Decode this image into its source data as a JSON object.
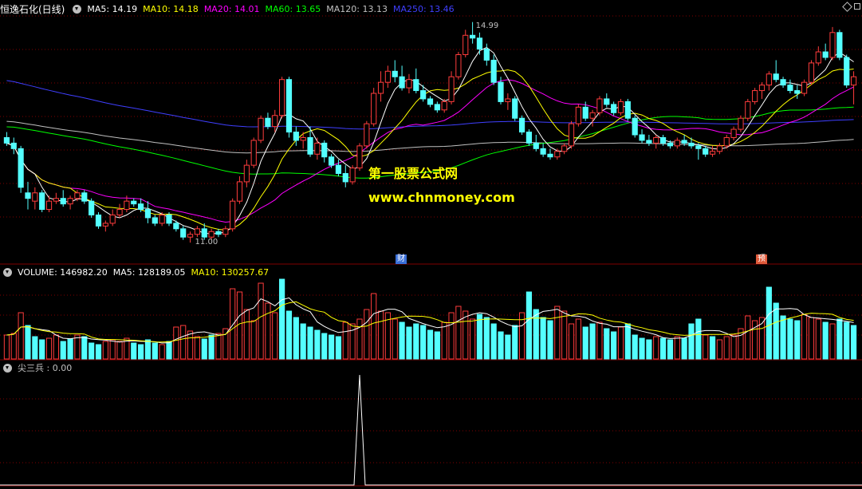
{
  "header": {
    "title": "恒逸石化(日线)",
    "indicators": [
      {
        "label": "MA5: 14.19",
        "color": "#ffffff"
      },
      {
        "label": "MA10: 14.18",
        "color": "#ffff00"
      },
      {
        "label": "MA20: 14.01",
        "color": "#ff00ff"
      },
      {
        "label": "MA60: 13.65",
        "color": "#00ff00"
      },
      {
        "label": "MA120: 13.13",
        "color": "#c0c0c0"
      },
      {
        "label": "MA250: 13.46",
        "color": "#3f3fff"
      }
    ]
  },
  "volume_header": {
    "indicators": [
      {
        "label": "VOLUME: 146982.20",
        "color": "#ffffff"
      },
      {
        "label": "MA5: 128189.05",
        "color": "#ffffff"
      },
      {
        "label": "MA10: 130257.67",
        "color": "#ffff00"
      }
    ]
  },
  "signal_header": {
    "indicators": [
      {
        "label": "尖三兵 : 0.00",
        "color": "#c0c0c0"
      }
    ]
  },
  "annotations": {
    "high_label": "14.99",
    "low_label": "11.00",
    "flag_financial": "财",
    "flag_forecast": "预"
  },
  "watermark": {
    "line1": "第一股票公式网",
    "line2": "www.chnmoney.com"
  },
  "colors": {
    "up": "#ff3c3c",
    "down": "#54ffff",
    "grid": "#800000",
    "ma5": "#ffffff",
    "ma10": "#ffff00",
    "ma20": "#ff00ff",
    "ma60": "#00ff00",
    "ma120": "#c0c0c0",
    "ma250": "#3f3fff",
    "signal": "#ffffff"
  },
  "chart_data": {
    "type": "candlestick",
    "ylim": [
      10.8,
      15.1
    ],
    "candles": [
      [
        12.9,
        13.0,
        12.75,
        12.8
      ],
      [
        12.8,
        12.9,
        12.6,
        12.7
      ],
      [
        12.7,
        12.75,
        11.9,
        12.0
      ],
      [
        11.9,
        12.1,
        11.6,
        11.8
      ],
      [
        11.75,
        12.0,
        11.6,
        11.9
      ],
      [
        11.9,
        11.95,
        11.55,
        11.6
      ],
      [
        11.6,
        11.85,
        11.55,
        11.75
      ],
      [
        11.75,
        11.9,
        11.7,
        11.8
      ],
      [
        11.8,
        11.95,
        11.65,
        11.7
      ],
      [
        11.7,
        11.85,
        11.6,
        11.8
      ],
      [
        11.8,
        11.95,
        11.75,
        11.9
      ],
      [
        11.9,
        11.95,
        11.7,
        11.75
      ],
      [
        11.75,
        11.8,
        11.45,
        11.5
      ],
      [
        11.5,
        11.55,
        11.25,
        11.3
      ],
      [
        11.3,
        11.4,
        11.2,
        11.35
      ],
      [
        11.35,
        11.6,
        11.3,
        11.5
      ],
      [
        11.5,
        11.7,
        11.45,
        11.6
      ],
      [
        11.6,
        11.85,
        11.55,
        11.75
      ],
      [
        11.75,
        11.8,
        11.65,
        11.7
      ],
      [
        11.7,
        11.8,
        11.55,
        11.6
      ],
      [
        11.6,
        11.75,
        11.35,
        11.45
      ],
      [
        11.45,
        11.5,
        11.3,
        11.35
      ],
      [
        11.35,
        11.55,
        11.3,
        11.5
      ],
      [
        11.5,
        11.55,
        11.3,
        11.35
      ],
      [
        11.35,
        11.4,
        11.2,
        11.25
      ],
      [
        11.25,
        11.3,
        11.05,
        11.1
      ],
      [
        11.1,
        11.2,
        11.0,
        11.15
      ],
      [
        11.15,
        11.3,
        11.1,
        11.25
      ],
      [
        11.25,
        11.35,
        11.05,
        11.1
      ],
      [
        11.1,
        11.25,
        11.05,
        11.2
      ],
      [
        11.2,
        11.25,
        11.1,
        11.15
      ],
      [
        11.15,
        11.3,
        11.1,
        11.25
      ],
      [
        11.25,
        11.8,
        11.2,
        11.75
      ],
      [
        11.75,
        12.2,
        11.7,
        12.1
      ],
      [
        12.1,
        12.5,
        12.0,
        12.4
      ],
      [
        12.4,
        12.9,
        12.35,
        12.85
      ],
      [
        12.85,
        13.3,
        12.8,
        13.25
      ],
      [
        13.25,
        13.35,
        13.05,
        13.1
      ],
      [
        13.1,
        13.4,
        13.0,
        13.3
      ],
      [
        13.3,
        14.0,
        13.25,
        13.95
      ],
      [
        13.95,
        14.0,
        12.9,
        13.0
      ],
      [
        13.0,
        13.1,
        12.75,
        12.85
      ],
      [
        12.85,
        13.0,
        12.7,
        12.9
      ],
      [
        12.9,
        13.1,
        12.55,
        12.6
      ],
      [
        12.6,
        12.9,
        12.5,
        12.8
      ],
      [
        12.8,
        12.85,
        12.45,
        12.55
      ],
      [
        12.55,
        12.6,
        12.35,
        12.4
      ],
      [
        12.4,
        12.5,
        12.2,
        12.25
      ],
      [
        12.25,
        12.4,
        12.0,
        12.1
      ],
      [
        12.1,
        12.4,
        12.05,
        12.35
      ],
      [
        12.35,
        12.8,
        12.3,
        12.75
      ],
      [
        12.75,
        13.2,
        12.7,
        13.15
      ],
      [
        13.15,
        13.8,
        13.1,
        13.7
      ],
      [
        13.7,
        14.1,
        13.55,
        13.9
      ],
      [
        13.9,
        14.2,
        13.8,
        14.1
      ],
      [
        14.1,
        14.3,
        13.9,
        14.0
      ],
      [
        14.0,
        14.2,
        13.75,
        13.8
      ],
      [
        13.8,
        14.05,
        13.7,
        13.95
      ],
      [
        13.95,
        14.15,
        13.7,
        13.75
      ],
      [
        13.75,
        13.85,
        13.55,
        13.6
      ],
      [
        13.6,
        13.65,
        13.45,
        13.5
      ],
      [
        13.5,
        13.55,
        13.35,
        13.4
      ],
      [
        13.4,
        13.6,
        13.35,
        13.55
      ],
      [
        13.55,
        14.1,
        13.5,
        14.0
      ],
      [
        14.0,
        14.45,
        13.95,
        14.4
      ],
      [
        14.4,
        14.85,
        14.35,
        14.75
      ],
      [
        14.75,
        14.99,
        14.6,
        14.7
      ],
      [
        14.7,
        14.8,
        14.4,
        14.5
      ],
      [
        14.5,
        14.6,
        14.2,
        14.3
      ],
      [
        14.3,
        14.4,
        13.85,
        13.9
      ],
      [
        13.9,
        14.0,
        13.5,
        13.55
      ],
      [
        13.55,
        13.7,
        13.4,
        13.6
      ],
      [
        13.6,
        13.65,
        13.2,
        13.25
      ],
      [
        13.25,
        13.3,
        12.95,
        13.0
      ],
      [
        13.0,
        13.05,
        12.75,
        12.8
      ],
      [
        12.8,
        12.95,
        12.65,
        12.7
      ],
      [
        12.7,
        12.8,
        12.55,
        12.6
      ],
      [
        12.6,
        12.7,
        12.5,
        12.55
      ],
      [
        12.55,
        12.7,
        12.5,
        12.65
      ],
      [
        12.65,
        12.8,
        12.6,
        12.75
      ],
      [
        12.75,
        13.2,
        12.7,
        13.15
      ],
      [
        13.15,
        13.5,
        13.1,
        13.45
      ],
      [
        13.45,
        13.55,
        13.2,
        13.25
      ],
      [
        13.25,
        13.4,
        13.1,
        13.35
      ],
      [
        13.35,
        13.65,
        13.3,
        13.6
      ],
      [
        13.6,
        13.7,
        13.45,
        13.5
      ],
      [
        13.5,
        13.55,
        13.3,
        13.35
      ],
      [
        13.35,
        13.6,
        13.3,
        13.55
      ],
      [
        13.55,
        13.6,
        13.2,
        13.25
      ],
      [
        13.25,
        13.3,
        12.9,
        12.95
      ],
      [
        12.95,
        13.05,
        12.8,
        12.85
      ],
      [
        12.85,
        12.95,
        12.75,
        12.8
      ],
      [
        12.8,
        12.95,
        12.7,
        12.9
      ],
      [
        12.9,
        12.95,
        12.75,
        12.8
      ],
      [
        12.8,
        12.85,
        12.7,
        12.75
      ],
      [
        12.75,
        12.9,
        12.7,
        12.85
      ],
      [
        12.85,
        12.95,
        12.75,
        12.8
      ],
      [
        12.8,
        12.9,
        12.7,
        12.75
      ],
      [
        12.75,
        12.8,
        12.5,
        12.7
      ],
      [
        12.7,
        12.75,
        12.55,
        12.6
      ],
      [
        12.6,
        12.75,
        12.55,
        12.65
      ],
      [
        12.65,
        12.8,
        12.6,
        12.75
      ],
      [
        12.75,
        12.95,
        12.7,
        12.9
      ],
      [
        12.9,
        13.1,
        12.85,
        13.05
      ],
      [
        13.05,
        13.3,
        13.0,
        13.25
      ],
      [
        13.25,
        13.6,
        13.2,
        13.55
      ],
      [
        13.55,
        13.8,
        13.5,
        13.75
      ],
      [
        13.75,
        13.9,
        13.6,
        13.85
      ],
      [
        13.85,
        14.1,
        13.75,
        14.05
      ],
      [
        14.05,
        14.3,
        13.9,
        13.95
      ],
      [
        13.95,
        14.0,
        13.8,
        13.85
      ],
      [
        13.85,
        13.95,
        13.7,
        13.75
      ],
      [
        13.75,
        13.85,
        13.6,
        13.7
      ],
      [
        13.7,
        13.95,
        13.65,
        13.9
      ],
      [
        13.9,
        14.3,
        13.85,
        14.25
      ],
      [
        14.25,
        14.55,
        14.2,
        14.45
      ],
      [
        14.45,
        14.6,
        14.3,
        14.35
      ],
      [
        14.35,
        14.9,
        14.3,
        14.8
      ],
      [
        14.8,
        14.85,
        14.3,
        14.35
      ],
      [
        14.35,
        14.4,
        13.8,
        13.85
      ],
      [
        13.85,
        14.1,
        13.5,
        14.0
      ]
    ],
    "volume": [
      [
        30,
        1
      ],
      [
        32,
        1
      ],
      [
        58,
        1
      ],
      [
        42,
        0
      ],
      [
        28,
        0
      ],
      [
        24,
        0
      ],
      [
        26,
        1
      ],
      [
        30,
        1
      ],
      [
        22,
        0
      ],
      [
        25,
        0
      ],
      [
        30,
        1
      ],
      [
        28,
        0
      ],
      [
        20,
        0
      ],
      [
        18,
        0
      ],
      [
        22,
        1
      ],
      [
        24,
        1
      ],
      [
        22,
        1
      ],
      [
        26,
        1
      ],
      [
        20,
        0
      ],
      [
        18,
        0
      ],
      [
        24,
        0
      ],
      [
        20,
        0
      ],
      [
        18,
        1
      ],
      [
        22,
        0
      ],
      [
        40,
        1
      ],
      [
        42,
        1
      ],
      [
        35,
        1
      ],
      [
        28,
        1
      ],
      [
        25,
        0
      ],
      [
        30,
        0
      ],
      [
        32,
        1
      ],
      [
        38,
        1
      ],
      [
        88,
        1
      ],
      [
        84,
        1
      ],
      [
        62,
        1
      ],
      [
        48,
        1
      ],
      [
        95,
        1
      ],
      [
        70,
        1
      ],
      [
        58,
        1
      ],
      [
        100,
        0
      ],
      [
        60,
        0
      ],
      [
        52,
        0
      ],
      [
        44,
        0
      ],
      [
        40,
        0
      ],
      [
        36,
        0
      ],
      [
        32,
        0
      ],
      [
        30,
        0
      ],
      [
        28,
        0
      ],
      [
        46,
        1
      ],
      [
        44,
        1
      ],
      [
        50,
        1
      ],
      [
        62,
        1
      ],
      [
        82,
        1
      ],
      [
        60,
        1
      ],
      [
        58,
        1
      ],
      [
        50,
        1
      ],
      [
        46,
        0
      ],
      [
        40,
        0
      ],
      [
        44,
        0
      ],
      [
        42,
        0
      ],
      [
        36,
        0
      ],
      [
        34,
        0
      ],
      [
        46,
        1
      ],
      [
        58,
        1
      ],
      [
        66,
        1
      ],
      [
        60,
        1
      ],
      [
        50,
        1
      ],
      [
        56,
        0
      ],
      [
        52,
        0
      ],
      [
        44,
        0
      ],
      [
        34,
        0
      ],
      [
        30,
        0
      ],
      [
        42,
        0
      ],
      [
        58,
        1
      ],
      [
        84,
        0
      ],
      [
        62,
        0
      ],
      [
        52,
        0
      ],
      [
        48,
        0
      ],
      [
        66,
        1
      ],
      [
        60,
        1
      ],
      [
        44,
        1
      ],
      [
        50,
        1
      ],
      [
        40,
        0
      ],
      [
        44,
        0
      ],
      [
        46,
        1
      ],
      [
        38,
        0
      ],
      [
        34,
        0
      ],
      [
        40,
        1
      ],
      [
        44,
        0
      ],
      [
        30,
        0
      ],
      [
        26,
        0
      ],
      [
        24,
        0
      ],
      [
        28,
        1
      ],
      [
        26,
        0
      ],
      [
        24,
        0
      ],
      [
        28,
        1
      ],
      [
        26,
        0
      ],
      [
        44,
        0
      ],
      [
        50,
        0
      ],
      [
        30,
        1
      ],
      [
        28,
        0
      ],
      [
        24,
        1
      ],
      [
        28,
        1
      ],
      [
        30,
        1
      ],
      [
        38,
        1
      ],
      [
        54,
        1
      ],
      [
        48,
        1
      ],
      [
        52,
        1
      ],
      [
        90,
        0
      ],
      [
        70,
        0
      ],
      [
        54,
        0
      ],
      [
        50,
        0
      ],
      [
        48,
        0
      ],
      [
        56,
        1
      ],
      [
        52,
        1
      ],
      [
        50,
        1
      ],
      [
        46,
        0
      ],
      [
        44,
        1
      ],
      [
        50,
        0
      ],
      [
        46,
        0
      ],
      [
        42,
        0
      ]
    ],
    "signal_x_index": 50,
    "signal_value": 1
  }
}
